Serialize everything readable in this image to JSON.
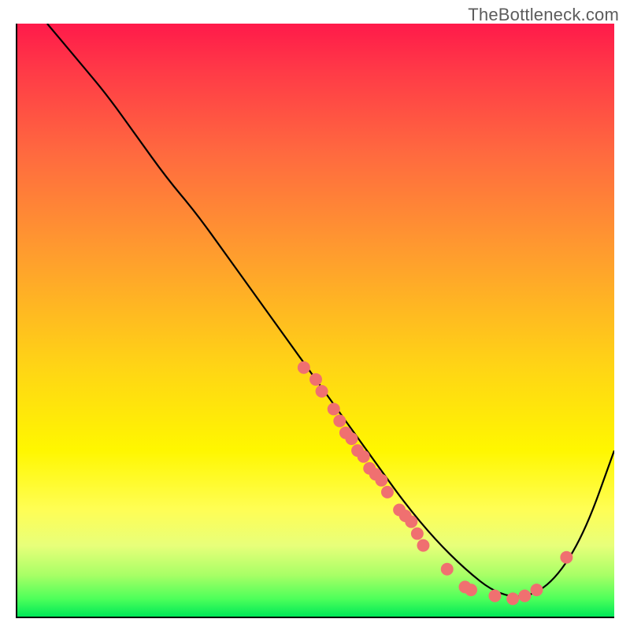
{
  "watermark": "TheBottleneck.com",
  "chart_data": {
    "type": "line",
    "title": "",
    "xlabel": "",
    "ylabel": "",
    "xlim": [
      0,
      100
    ],
    "ylim": [
      0,
      100
    ],
    "grid": false,
    "background_gradient": [
      "#ff1a4a",
      "#ff6a3f",
      "#ffd515",
      "#fff700",
      "#4dff5a",
      "#00e858"
    ],
    "series": [
      {
        "name": "bottleneck-curve",
        "color": "#000000",
        "x": [
          5,
          10,
          15,
          20,
          25,
          30,
          35,
          40,
          45,
          50,
          55,
          60,
          65,
          70,
          75,
          80,
          85,
          90,
          95,
          100
        ],
        "values": [
          100,
          94,
          88,
          81,
          74,
          68,
          61,
          54,
          47,
          40,
          33,
          26,
          19,
          13,
          8,
          4,
          3,
          6,
          14,
          28
        ]
      }
    ],
    "markers": {
      "name": "highlight-dots",
      "color": "#f07070",
      "radius": 8,
      "points": [
        {
          "x": 48,
          "y": 42
        },
        {
          "x": 50,
          "y": 40
        },
        {
          "x": 51,
          "y": 38
        },
        {
          "x": 53,
          "y": 35
        },
        {
          "x": 54,
          "y": 33
        },
        {
          "x": 55,
          "y": 31
        },
        {
          "x": 56,
          "y": 30
        },
        {
          "x": 57,
          "y": 28
        },
        {
          "x": 58,
          "y": 27
        },
        {
          "x": 59,
          "y": 25
        },
        {
          "x": 60,
          "y": 24
        },
        {
          "x": 61,
          "y": 23
        },
        {
          "x": 62,
          "y": 21
        },
        {
          "x": 64,
          "y": 18
        },
        {
          "x": 65,
          "y": 17
        },
        {
          "x": 66,
          "y": 16
        },
        {
          "x": 67,
          "y": 14
        },
        {
          "x": 68,
          "y": 12
        },
        {
          "x": 72,
          "y": 8
        },
        {
          "x": 75,
          "y": 5
        },
        {
          "x": 76,
          "y": 4.5
        },
        {
          "x": 80,
          "y": 3.5
        },
        {
          "x": 83,
          "y": 3
        },
        {
          "x": 85,
          "y": 3.5
        },
        {
          "x": 87,
          "y": 4.5
        },
        {
          "x": 92,
          "y": 10
        }
      ]
    }
  }
}
